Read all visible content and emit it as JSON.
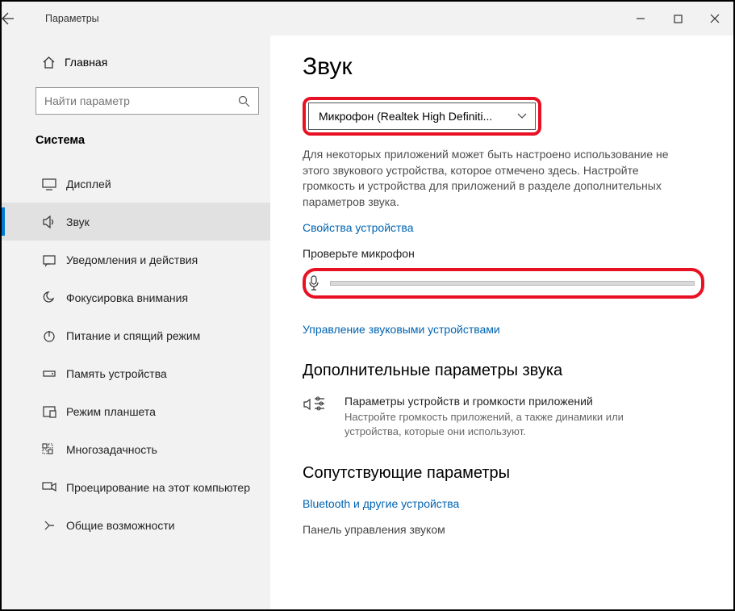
{
  "window": {
    "title": "Параметры"
  },
  "sidebar": {
    "home": "Главная",
    "search_placeholder": "Найти параметр",
    "category": "Система",
    "items": [
      {
        "label": "Дисплей"
      },
      {
        "label": "Звук"
      },
      {
        "label": "Уведомления и действия"
      },
      {
        "label": "Фокусировка внимания"
      },
      {
        "label": "Питание и спящий режим"
      },
      {
        "label": "Память устройства"
      },
      {
        "label": "Режим планшета"
      },
      {
        "label": "Многозадачность"
      },
      {
        "label": "Проецирование на этот компьютер"
      },
      {
        "label": "Общие возможности"
      }
    ]
  },
  "main": {
    "heading": "Звук",
    "input_device": "Микрофон (Realtek High Definiti...",
    "input_note": "Для некоторых приложений может быть настроено использование не этого звукового устройства, которое отмечено здесь. Настройте громкость и устройства для приложений в разделе дополнительных параметров звука.",
    "device_props_link": "Свойства устройства",
    "test_mic_label": "Проверьте микрофон",
    "manage_devices_link": "Управление звуковыми устройствами",
    "advanced_heading": "Дополнительные параметры звука",
    "appvol": {
      "title": "Параметры устройств и громкости приложений",
      "desc": "Настройте громкость приложений, а также динамики или устройства, которые они используют."
    },
    "related_heading": "Сопутствующие параметры",
    "related_link1": "Bluetooth и другие устройства",
    "related_link2": "Панель управления звуком"
  }
}
